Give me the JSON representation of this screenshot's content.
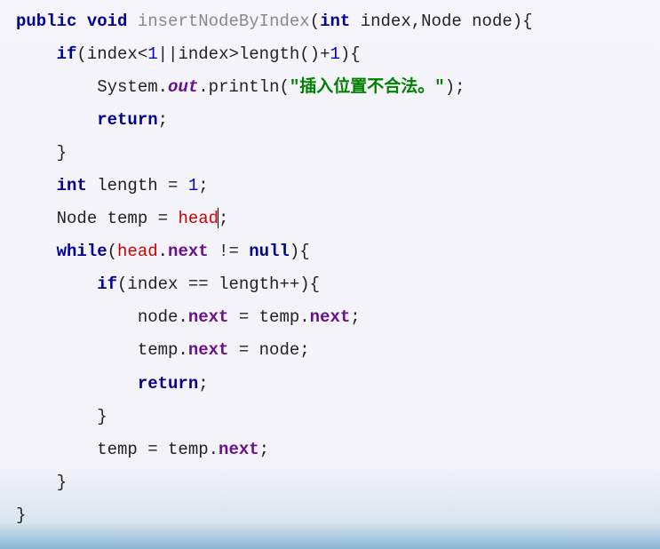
{
  "code": {
    "l1": {
      "kw1": "public",
      "kw2": "void",
      "fn": "insertNodeByIndex",
      "kw3": "int",
      "p1": "index",
      "p2": "Node node"
    },
    "l2": {
      "kw": "if",
      "expr_a": "(index<",
      "num1": "1",
      "expr_b": "||index>length()+",
      "num2": "1",
      "expr_c": "){"
    },
    "l3": {
      "obj": "System.",
      "field": "out",
      "call": ".println(",
      "str": "\"插入位置不合法。\"",
      "end": ");"
    },
    "l4": {
      "kw": "return",
      "end": ";"
    },
    "l5": {
      "brace": "}"
    },
    "l6": {
      "kw": "int",
      "txt": " length = ",
      "num": "1",
      "end": ";"
    },
    "l7": {
      "txt1": "Node temp = ",
      "err": "head",
      "end": ";"
    },
    "l8": {
      "kw": "while",
      "open": "(",
      "err": "head",
      "dot": ".",
      "prop": "next",
      "mid": " != ",
      "kw2": "null",
      "end": "){"
    },
    "l9": {
      "kw": "if",
      "expr": "(index == length++){"
    },
    "l10": {
      "txt1": "node.",
      "prop1": "next",
      "mid": " = temp.",
      "prop2": "next",
      "end": ";"
    },
    "l11": {
      "txt1": "temp.",
      "prop1": "next",
      "mid": " = node;"
    },
    "l12": {
      "kw": "return",
      "end": ";"
    },
    "l13": {
      "brace": "}"
    },
    "l14": {
      "txt1": "temp = temp.",
      "prop": "next",
      "end": ";"
    },
    "l15": {
      "brace": "}"
    },
    "l16": {
      "brace": "}"
    }
  }
}
